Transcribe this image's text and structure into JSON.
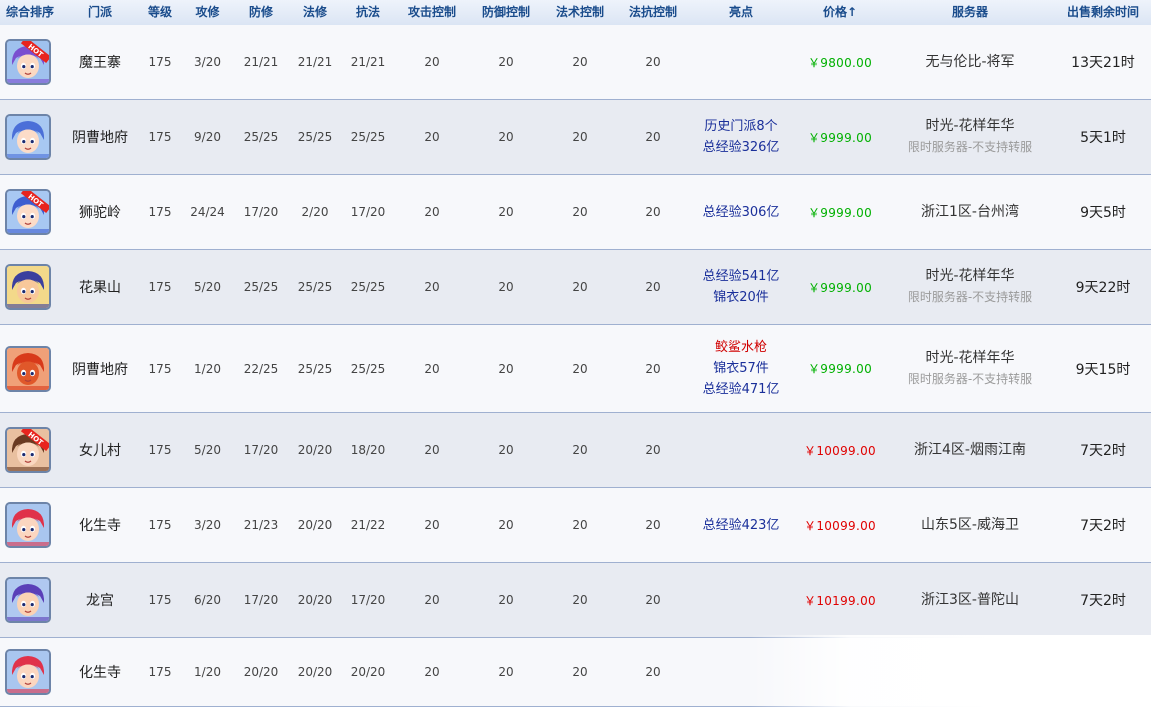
{
  "header": {
    "sort": "综合排序",
    "school": "门派",
    "level": "等级",
    "atk": "攻修",
    "def": "防修",
    "mag": "法修",
    "res": "抗法",
    "atk_ctrl": "攻击控制",
    "def_ctrl": "防御控制",
    "mag_ctrl": "法术控制",
    "res_ctrl": "法抗控制",
    "highlight": "亮点",
    "price": "价格↑",
    "server": "服务器",
    "time": "出售剩余时间"
  },
  "colors": {
    "header_text": "#1a4c8c",
    "price_green": "#00b000",
    "price_red": "#e00000",
    "highlight_blue": "#1a2f9a",
    "highlight_red": "#d00000",
    "note_gray": "#9a9a9a"
  },
  "rows": [
    {
      "avatar": "purple-hair-hot-icon",
      "hot": true,
      "hot_label": "HOT",
      "school": "魔王寨",
      "level": "175",
      "atk": "3/20",
      "def": "21/21",
      "mag": "21/21",
      "res": "21/21",
      "atk_ctrl": "20",
      "def_ctrl": "20",
      "mag_ctrl": "20",
      "res_ctrl": "20",
      "highlights": [],
      "price": "￥9800.00",
      "price_color": "green",
      "server": "无与伦比-将军",
      "server_note": "",
      "time": "13天21时"
    },
    {
      "avatar": "blue-hair-icon",
      "hot": false,
      "school": "阴曹地府",
      "level": "175",
      "atk": "9/20",
      "def": "25/25",
      "mag": "25/25",
      "res": "25/25",
      "atk_ctrl": "20",
      "def_ctrl": "20",
      "mag_ctrl": "20",
      "res_ctrl": "20",
      "highlights": [
        {
          "text": "历史门派8个",
          "color": "blue"
        },
        {
          "text": "总经验326亿",
          "color": "blue"
        }
      ],
      "price": "￥9999.00",
      "price_color": "green",
      "server": "时光-花样年华",
      "server_note": "限时服务器-不支持转服",
      "time": "5天1时"
    },
    {
      "avatar": "blue-hair-hot-icon",
      "hot": true,
      "hot_label": "HOT",
      "school": "狮驼岭",
      "level": "175",
      "atk": "24/24",
      "def": "17/20",
      "mag": "2/20",
      "res": "17/20",
      "atk_ctrl": "20",
      "def_ctrl": "20",
      "mag_ctrl": "20",
      "res_ctrl": "20",
      "highlights": [
        {
          "text": "总经验306亿",
          "color": "blue"
        }
      ],
      "price": "￥9999.00",
      "price_color": "green",
      "server": "浙江1区-台州湾",
      "server_note": "",
      "time": "9天5时"
    },
    {
      "avatar": "monkey-boy-icon",
      "hot": false,
      "school": "花果山",
      "level": "175",
      "atk": "5/20",
      "def": "25/25",
      "mag": "25/25",
      "res": "25/25",
      "atk_ctrl": "20",
      "def_ctrl": "20",
      "mag_ctrl": "20",
      "res_ctrl": "20",
      "highlights": [
        {
          "text": "总经验541亿",
          "color": "blue"
        },
        {
          "text": "锦衣20件",
          "color": "blue"
        }
      ],
      "price": "￥9999.00",
      "price_color": "green",
      "server": "时光-花样年华",
      "server_note": "限时服务器-不支持转服",
      "time": "9天22时"
    },
    {
      "avatar": "red-demon-icon",
      "hot": false,
      "school": "阴曹地府",
      "level": "175",
      "atk": "1/20",
      "def": "22/25",
      "mag": "25/25",
      "res": "25/25",
      "atk_ctrl": "20",
      "def_ctrl": "20",
      "mag_ctrl": "20",
      "res_ctrl": "20",
      "highlights": [
        {
          "text": "鲛鲨水枪",
          "color": "red"
        },
        {
          "text": "锦衣57件",
          "color": "blue"
        },
        {
          "text": "总经验471亿",
          "color": "blue"
        }
      ],
      "price": "￥9999.00",
      "price_color": "green",
      "server": "时光-花样年华",
      "server_note": "限时服务器-不支持转服",
      "time": "9天15时"
    },
    {
      "avatar": "girl-hot-icon",
      "hot": true,
      "hot_label": "HOT",
      "school": "女儿村",
      "level": "175",
      "atk": "5/20",
      "def": "17/20",
      "mag": "20/20",
      "res": "18/20",
      "atk_ctrl": "20",
      "def_ctrl": "20",
      "mag_ctrl": "20",
      "res_ctrl": "20",
      "highlights": [],
      "price": "￥10099.00",
      "price_color": "red",
      "server": "浙江4区-烟雨江南",
      "server_note": "",
      "time": "7天2时"
    },
    {
      "avatar": "red-hair-icon",
      "hot": false,
      "school": "化生寺",
      "level": "175",
      "atk": "3/20",
      "def": "21/23",
      "mag": "20/20",
      "res": "21/22",
      "atk_ctrl": "20",
      "def_ctrl": "20",
      "mag_ctrl": "20",
      "res_ctrl": "20",
      "highlights": [
        {
          "text": "总经验423亿",
          "color": "blue"
        }
      ],
      "price": "￥10099.00",
      "price_color": "red",
      "server": "山东5区-威海卫",
      "server_note": "",
      "time": "7天2时"
    },
    {
      "avatar": "purple-boy-icon",
      "hot": false,
      "school": "龙宫",
      "level": "175",
      "atk": "6/20",
      "def": "17/20",
      "mag": "20/20",
      "res": "17/20",
      "atk_ctrl": "20",
      "def_ctrl": "20",
      "mag_ctrl": "20",
      "res_ctrl": "20",
      "highlights": [],
      "price": "￥10199.00",
      "price_color": "red",
      "server": "浙江3区-普陀山",
      "server_note": "",
      "time": "7天2时"
    },
    {
      "avatar": "red-hair-icon",
      "hot": false,
      "school": "化生寺",
      "level": "175",
      "atk": "1/20",
      "def": "20/20",
      "mag": "20/20",
      "res": "20/20",
      "atk_ctrl": "20",
      "def_ctrl": "20",
      "mag_ctrl": "20",
      "res_ctrl": "20",
      "highlights": [],
      "price": "",
      "price_color": "red",
      "server": "",
      "server_note": "",
      "time": ""
    }
  ]
}
